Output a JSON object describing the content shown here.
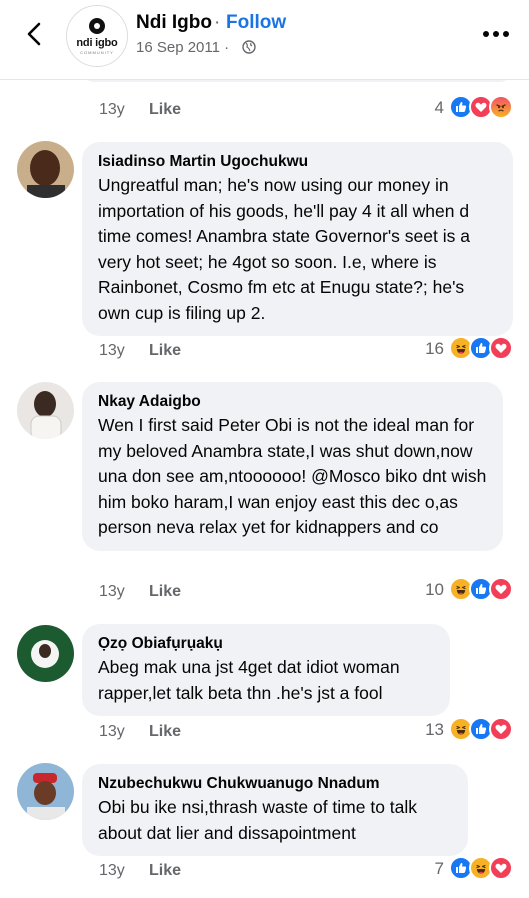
{
  "header": {
    "page_name": "Ndi Igbo",
    "separator": "·",
    "follow_label": "Follow",
    "date": "16 Sep 2011 ·",
    "avatar_text": "ndi igbo",
    "avatar_sub": "COMMUNITY"
  },
  "top_meta": {
    "time": "13y",
    "like_label": "Like",
    "reaction_count": "4",
    "reactions": [
      "like",
      "love",
      "angry"
    ]
  },
  "comments": [
    {
      "author": "Isiadinso Martin Ugochukwu",
      "text": "Ungreatful man; he's now using our money in importation of his goods, he'll pay 4 it all when d time comes! Anambra state Governor's seet is a very hot seet; he 4got so soon. I.e, where is Rainbonet, Cosmo fm etc at Enugu state?; he's own cup is filing up 2.",
      "time": "13y",
      "like_label": "Like",
      "reaction_count": "16",
      "reactions": [
        "haha",
        "like",
        "love"
      ]
    },
    {
      "author": "Nkay Adaigbo",
      "text": "Wen I first said Peter Obi is not the ideal man for my beloved Anambra state,I was shut down,now una don see am,ntoooooo! @Mosco biko dnt wish him boko haram,I wan enjoy east this dec o,as person neva relax yet for kidnappers and co",
      "time": "13y",
      "like_label": "Like",
      "reaction_count": "10",
      "reactions": [
        "haha",
        "like",
        "love"
      ]
    },
    {
      "author": "Ọzọ Obiafụrụakụ",
      "text": "Abeg mak una jst 4get dat idiot woman rapper,let talk beta thn .he's jst a fool",
      "time": "13y",
      "like_label": "Like",
      "reaction_count": "13",
      "reactions": [
        "haha",
        "like",
        "love"
      ]
    },
    {
      "author": "Nzubechukwu Chukwuanugo Nnadum",
      "text": "Obi bu ike nsi,thrash waste of time to talk about dat lier and dissapointment",
      "time": "13y",
      "like_label": "Like",
      "reaction_count": "7",
      "reactions": [
        "like",
        "haha",
        "love"
      ]
    }
  ],
  "colors": {
    "accent": "#1b74e4",
    "bubble": "#f0f2f5",
    "meta": "#65676b",
    "like": "#1877f2",
    "love": "#f33e58",
    "haha": "#f7b125"
  },
  "icons": [
    "back-arrow-icon",
    "globe-icon",
    "more-options-icon",
    "like-reaction-icon",
    "love-reaction-icon",
    "angry-reaction-icon",
    "haha-reaction-icon"
  ]
}
